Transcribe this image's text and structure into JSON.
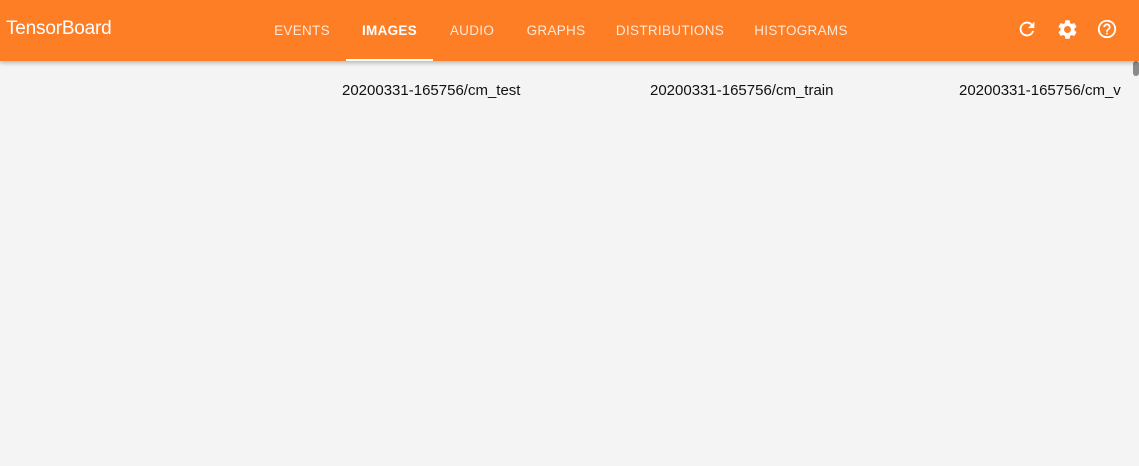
{
  "app": {
    "title": "TensorBoard"
  },
  "tabs": [
    {
      "label": "EVENTS",
      "active": false
    },
    {
      "label": "IMAGES",
      "active": true
    },
    {
      "label": "AUDIO",
      "active": false
    },
    {
      "label": "GRAPHS",
      "active": false
    },
    {
      "label": "DISTRIBUTIONS",
      "active": false
    },
    {
      "label": "HISTOGRAMS",
      "active": false
    }
  ],
  "toolbar_icons": [
    "refresh-icon",
    "settings-icon",
    "help-icon"
  ],
  "colors": {
    "header": "#fd7e24",
    "background": "#f4f4f4",
    "text": "#111111"
  },
  "run_titles": [
    "20200331-165756/cm_test",
    "20200331-165756/cm_train",
    "20200331-165756/cm_v"
  ]
}
